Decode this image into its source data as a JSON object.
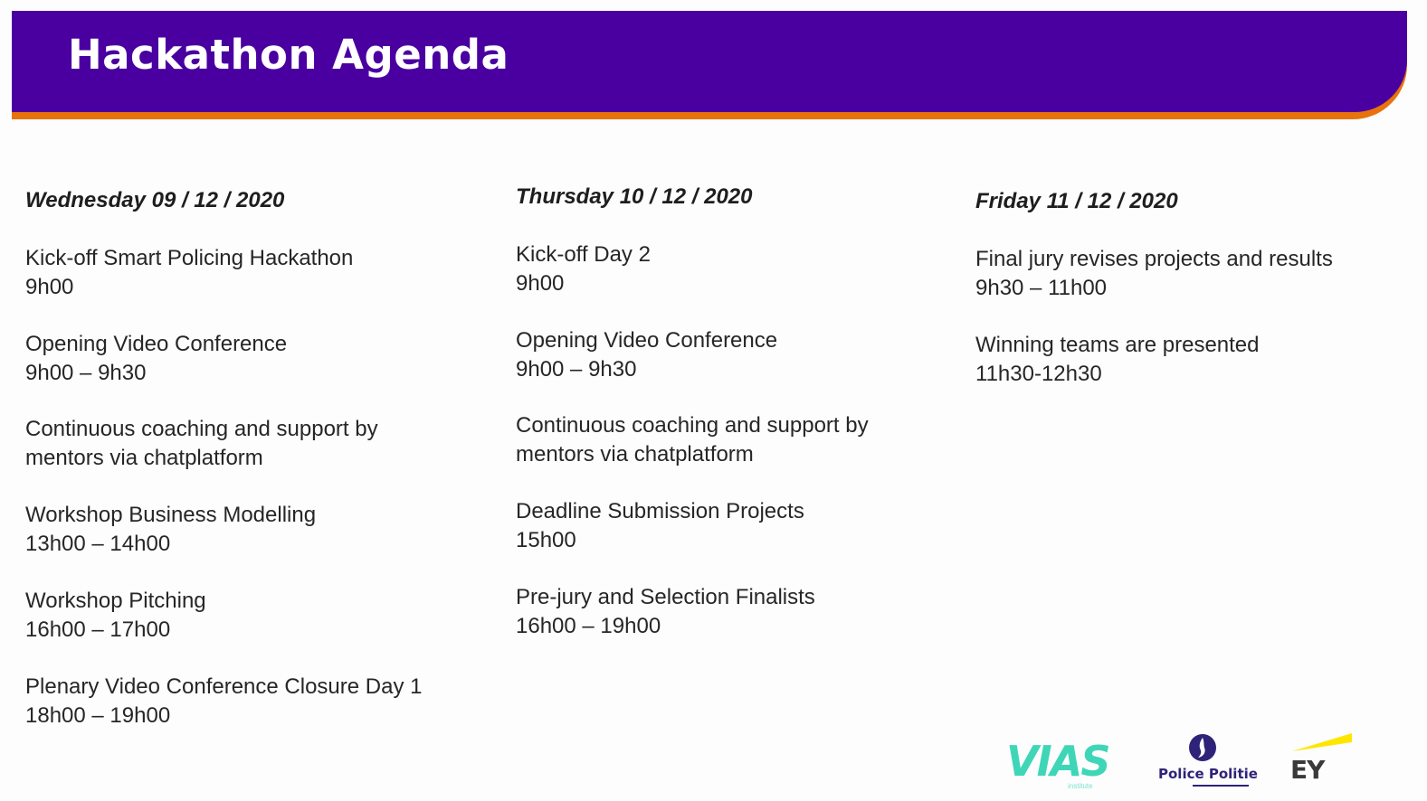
{
  "title": "Hackathon Agenda",
  "days": [
    {
      "heading": "Wednesday 09 / 12 / 2020",
      "items": [
        {
          "lines": [
            "Kick-off Smart Policing Hackathon",
            "9h00"
          ]
        },
        {
          "lines": [
            "Opening Video Conference",
            "9h00 – 9h30"
          ]
        },
        {
          "lines": [
            "Continuous coaching and support by",
            "mentors via chatplatform"
          ]
        },
        {
          "lines": [
            "Workshop Business Modelling",
            "13h00 – 14h00"
          ]
        },
        {
          "lines": [
            "Workshop Pitching",
            "16h00 – 17h00"
          ]
        },
        {
          "lines": [
            "Plenary Video Conference Closure Day 1",
            "18h00 – 19h00"
          ]
        }
      ]
    },
    {
      "heading": "Thursday 10 / 12 / 2020",
      "items": [
        {
          "lines": [
            "Kick-off Day 2",
            "9h00"
          ]
        },
        {
          "lines": [
            "Opening Video Conference",
            "9h00 – 9h30"
          ]
        },
        {
          "lines": [
            "Continuous coaching and support by",
            "mentors via chatplatform"
          ]
        },
        {
          "lines": [
            "Deadline Submission Projects",
            "15h00"
          ]
        },
        {
          "lines": [
            "Pre-jury and Selection Finalists",
            "16h00 – 19h00"
          ]
        }
      ]
    },
    {
      "heading": "Friday 11 / 12 / 2020",
      "items": [
        {
          "lines": [
            "Final jury revises projects and results",
            "9h30 – 11h00"
          ]
        },
        {
          "lines": [
            "Winning teams are presented",
            "11h30-12h30"
          ]
        }
      ]
    }
  ],
  "logos": {
    "vias": "VIAS",
    "vias_sub": "institute",
    "police": "Police Politie",
    "ey": "EY"
  },
  "colors": {
    "banner": "#4a00a0",
    "banner_accent": "#e8720c",
    "vias": "#3fd6b7",
    "police": "#2e2378",
    "ey_beam": "#ffe600"
  }
}
